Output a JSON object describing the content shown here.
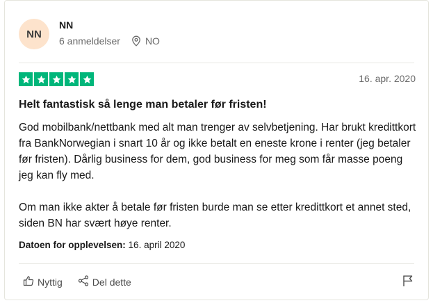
{
  "user": {
    "initials": "NN",
    "name": "NN",
    "reviews_count": "6 anmeldelser",
    "country": "NO"
  },
  "review": {
    "rating": 5,
    "date": "16. apr. 2020",
    "title": "Helt fantastisk så lenge man betaler før fristen!",
    "paragraphs": [
      "God mobilbank/nettbank med alt man trenger av selvbetjening. Har brukt kredittkort fra BankNorwegian i snart 10 år og ikke betalt en eneste krone i renter (jeg betaler før fristen). Dårlig business for dem, god business for meg som får masse poeng jeg kan fly med.",
      "Om man ikke akter å betale før fristen burde man se etter kredittkort et annet sted, siden BN har svært høye renter."
    ],
    "experience_label": "Datoen for opplevelsen:",
    "experience_date": "16. april 2020",
    "star_color": "#00b67a"
  },
  "actions": {
    "useful": "Nyttig",
    "share": "Del dette",
    "useful_icon": "thumbs-up-icon",
    "share_icon": "share-icon",
    "report_icon": "flag-icon"
  }
}
